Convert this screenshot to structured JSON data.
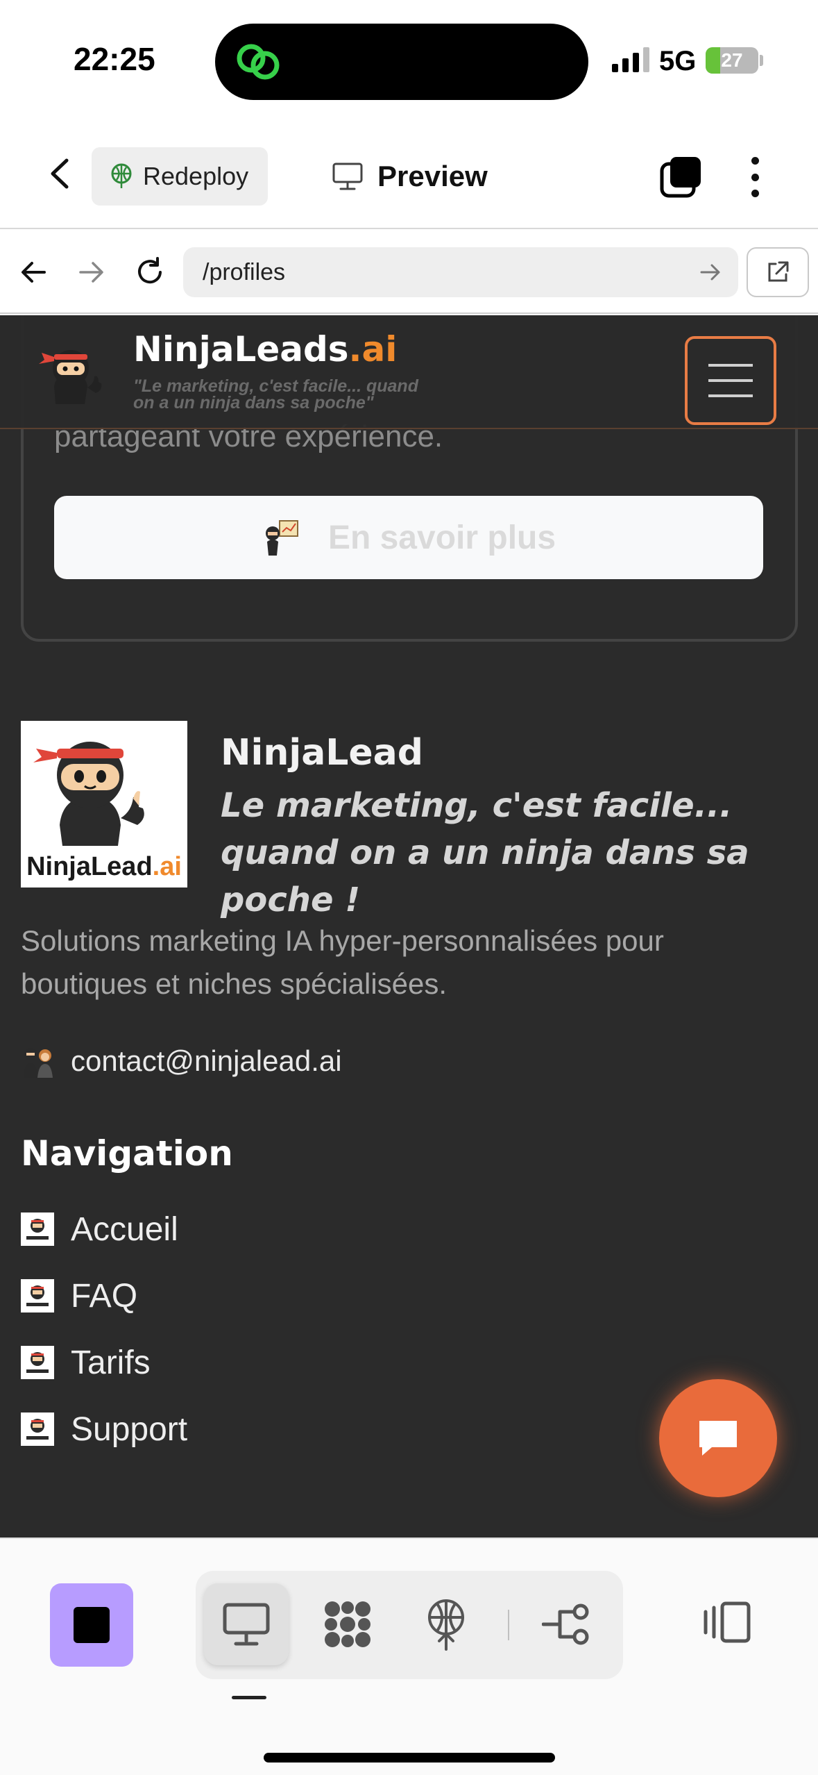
{
  "status_bar": {
    "time": "22:25",
    "network": "5G",
    "battery": "27",
    "battery_level": 0.27,
    "battery_color": "#67c23a",
    "island_icon": "link-rings-icon"
  },
  "toolbar": {
    "back_icon": "chevron-left-icon",
    "redeploy_label": "Redeploy",
    "preview_label": "Preview",
    "tabs_icon": "tabs-icon",
    "more_icon": "more-vertical-icon"
  },
  "browser": {
    "url": "/profiles"
  },
  "site": {
    "brand_main": "NinjaLeads",
    "brand_suffix": ".ai",
    "tagline": "\"Le marketing, c'est facile... quand on a un ninja dans sa poche\"",
    "accent_color": "#f08a2c",
    "card_text": "partageant votre expérience.",
    "learn_more_label": "En savoir plus",
    "logo_word": "NinjaLead",
    "logo_word_suffix": ".ai",
    "company_name": "NinjaLead",
    "slogan": "Le marketing, c'est facile... quand on a un ninja dans sa poche !",
    "description": "Solutions marketing IA hyper-personnalisées pour boutiques et niches spécialisées.",
    "contact_email": "contact@ninjalead.ai",
    "nav_title": "Navigation",
    "nav_items": [
      {
        "label": "Accueil"
      },
      {
        "label": "FAQ"
      },
      {
        "label": "Tarifs"
      },
      {
        "label": "Support"
      }
    ],
    "chat_color": "#e96b3b"
  },
  "bottom_bar": {
    "stop_color": "#b79cff",
    "icons": [
      "monitor-icon",
      "modules-icon",
      "deploy-icon",
      "workflow-icon",
      "layout-icon"
    ]
  }
}
